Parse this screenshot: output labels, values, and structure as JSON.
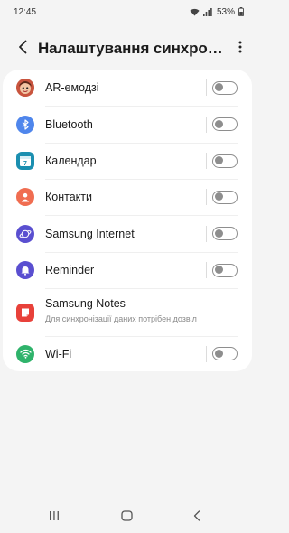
{
  "status_bar": {
    "time": "12:45",
    "battery": "53%"
  },
  "header": {
    "title": "Налаштування синхронізації облікового запису"
  },
  "items": [
    {
      "label": "AR-емодзі",
      "icon": "ar-emoji-avatar-icon",
      "toggle": false
    },
    {
      "label": "Bluetooth",
      "icon": "bluetooth-icon",
      "toggle": false
    },
    {
      "label": "Календар",
      "icon": "calendar-icon",
      "day": "7",
      "toggle": false
    },
    {
      "label": "Контакти",
      "icon": "contacts-icon",
      "toggle": false
    },
    {
      "label": "Samsung Internet",
      "icon": "samsung-internet-icon",
      "toggle": false
    },
    {
      "label": "Reminder",
      "icon": "reminder-bell-icon",
      "toggle": false
    },
    {
      "label": "Samsung Notes",
      "sublabel": "Для синхронізації даних потрібен дозвіл",
      "icon": "samsung-notes-icon"
    },
    {
      "label": "Wi-Fi",
      "icon": "wifi-icon",
      "toggle": false
    }
  ],
  "colors": {
    "bluetooth": "#4f86ec",
    "calendar": "#1b8fb0",
    "contacts": "#f06d51",
    "internet": "#5a4fd0",
    "reminder": "#5a4fd0",
    "notes": "#e8413a",
    "wifi": "#2fb36b",
    "toggle_off": "#8e8e8e"
  }
}
